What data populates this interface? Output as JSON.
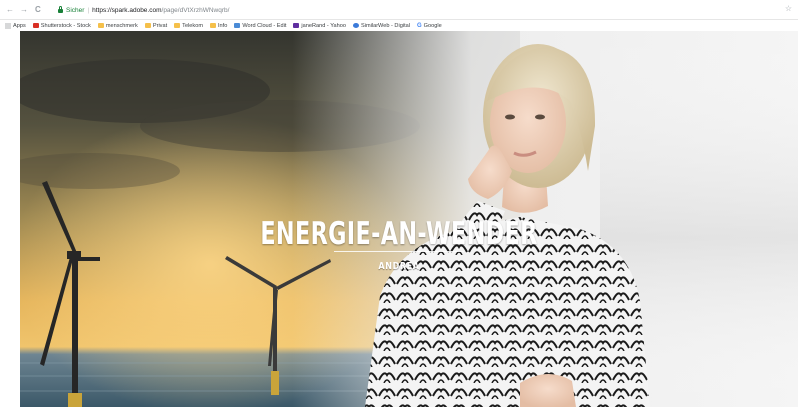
{
  "browser": {
    "nav": {
      "back": "←",
      "forward": "→",
      "reload": "C"
    },
    "secure_label": "Sicher",
    "separator": "|",
    "url_host": "https://spark.adobe.com",
    "url_path": "/page/dVtXrzhWNwqrb/",
    "bookmark_star": "☆"
  },
  "bookmarks": [
    {
      "label": "Apps",
      "icon": "apps-grid-icon"
    },
    {
      "label": "Shutterstock - Stock",
      "icon": "shutterstock-icon"
    },
    {
      "label": "menschmerk",
      "icon": "folder-icon"
    },
    {
      "label": "Privat",
      "icon": "folder-icon"
    },
    {
      "label": "Telekom",
      "icon": "folder-icon"
    },
    {
      "label": "Info",
      "icon": "folder-icon"
    },
    {
      "label": "Word Cloud - Edit",
      "icon": "wordcloud-icon"
    },
    {
      "label": "janeRand - Yahoo",
      "icon": "yahoo-icon"
    },
    {
      "label": "SimilarWeb - Digital",
      "icon": "similarweb-icon"
    },
    {
      "label": "Google",
      "icon": "google-icon"
    }
  ],
  "hero": {
    "headline": "ENERGIE-AN-WENDER",
    "subline": "ANDREA"
  },
  "colors": {
    "sky_dark": "#3e3e36",
    "sky_glow": "#e8b861",
    "sea": "#4d6b7b",
    "turbine": "#2b2b2b",
    "headline": "#ffffff"
  }
}
